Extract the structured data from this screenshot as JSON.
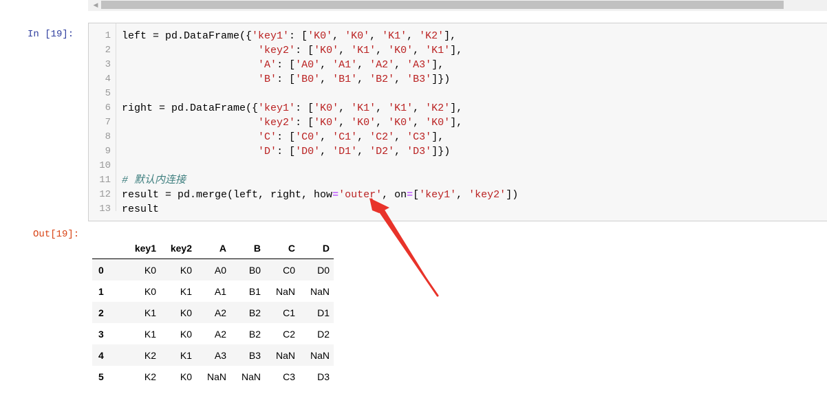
{
  "cell": {
    "in_prompt": "In  [19]:",
    "out_prompt": "Out[19]:",
    "line_numbers": [
      "1",
      "2",
      "3",
      "4",
      "5",
      "6",
      "7",
      "8",
      "9",
      "10",
      "11",
      "12",
      "13"
    ]
  },
  "code": {
    "l1a": "left = pd.DataFrame({",
    "l1s1": "'key1'",
    "l1b": ": [",
    "l1s2": "'K0'",
    "l1c": ", ",
    "l1s3": "'K0'",
    "l1d": ", ",
    "l1s4": "'K1'",
    "l1e": ", ",
    "l1s5": "'K2'",
    "l1f": "],",
    "l2pad": "                      ",
    "l2s1": "'key2'",
    "l2b": ": [",
    "l2s2": "'K0'",
    "l2c": ", ",
    "l2s3": "'K1'",
    "l2d": ", ",
    "l2s4": "'K0'",
    "l2e": ", ",
    "l2s5": "'K1'",
    "l2f": "],",
    "l3pad": "                      ",
    "l3s1": "'A'",
    "l3b": ": [",
    "l3s2": "'A0'",
    "l3c": ", ",
    "l3s3": "'A1'",
    "l3d": ", ",
    "l3s4": "'A2'",
    "l3e": ", ",
    "l3s5": "'A3'",
    "l3f": "],",
    "l4pad": "                      ",
    "l4s1": "'B'",
    "l4b": ": [",
    "l4s2": "'B0'",
    "l4c": ", ",
    "l4s3": "'B1'",
    "l4d": ", ",
    "l4s4": "'B2'",
    "l4e": ", ",
    "l4s5": "'B3'",
    "l4f": "]})",
    "l6a": "right = pd.DataFrame({",
    "l6s1": "'key1'",
    "l6b": ": [",
    "l6s2": "'K0'",
    "l6c": ", ",
    "l6s3": "'K1'",
    "l6d": ", ",
    "l6s4": "'K1'",
    "l6e": ", ",
    "l6s5": "'K2'",
    "l6f": "],",
    "l7pad": "                      ",
    "l7s1": "'key2'",
    "l7b": ": [",
    "l7s2": "'K0'",
    "l7c": ", ",
    "l7s3": "'K0'",
    "l7d": ", ",
    "l7s4": "'K0'",
    "l7e": ", ",
    "l7s5": "'K0'",
    "l7f": "],",
    "l8pad": "                      ",
    "l8s1": "'C'",
    "l8b": ": [",
    "l8s2": "'C0'",
    "l8c": ", ",
    "l8s3": "'C1'",
    "l8d": ", ",
    "l8s4": "'C2'",
    "l8e": ", ",
    "l8s5": "'C3'",
    "l8f": "],",
    "l9pad": "                      ",
    "l9s1": "'D'",
    "l9b": ": [",
    "l9s2": "'D0'",
    "l9c": ", ",
    "l9s3": "'D1'",
    "l9d": ", ",
    "l9s4": "'D2'",
    "l9e": ", ",
    "l9s5": "'D3'",
    "l9f": "]})",
    "l11": "# 默认内连接",
    "l12a": "result = pd.merge(left, right, how",
    "l12eq": "=",
    "l12s1": "'outer'",
    "l12b": ", on",
    "l12eq2": "=",
    "l12c": "[",
    "l12s2": "'key1'",
    "l12d": ", ",
    "l12s3": "'key2'",
    "l12e": "])",
    "l13": "result"
  },
  "table": {
    "columns": [
      "key1",
      "key2",
      "A",
      "B",
      "C",
      "D"
    ],
    "rows": [
      {
        "index": "0",
        "cells": [
          "K0",
          "K0",
          "A0",
          "B0",
          "C0",
          "D0"
        ]
      },
      {
        "index": "1",
        "cells": [
          "K0",
          "K1",
          "A1",
          "B1",
          "NaN",
          "NaN"
        ]
      },
      {
        "index": "2",
        "cells": [
          "K1",
          "K0",
          "A2",
          "B2",
          "C1",
          "D1"
        ]
      },
      {
        "index": "3",
        "cells": [
          "K1",
          "K0",
          "A2",
          "B2",
          "C2",
          "D2"
        ]
      },
      {
        "index": "4",
        "cells": [
          "K2",
          "K1",
          "A3",
          "B3",
          "NaN",
          "NaN"
        ]
      },
      {
        "index": "5",
        "cells": [
          "K2",
          "K0",
          "NaN",
          "NaN",
          "C3",
          "D3"
        ]
      }
    ]
  },
  "colors": {
    "in_prompt": "#303f9f",
    "out_prompt": "#d84315",
    "string": "#ba2121",
    "comment": "#408080",
    "annotation_arrow": "#e8332a"
  },
  "icons": {
    "scroll_left": "triangle-left-icon"
  }
}
